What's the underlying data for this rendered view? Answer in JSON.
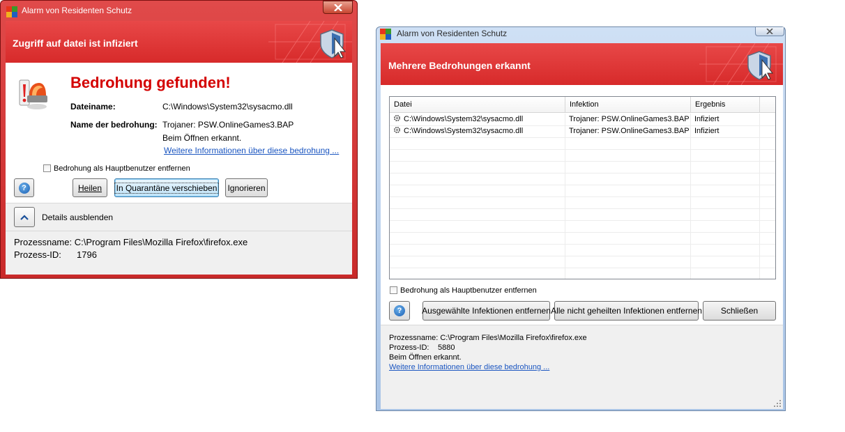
{
  "window1": {
    "title": "Alarm von Residenten Schutz",
    "banner_title": "Zugriff auf datei ist infiziert",
    "headline": "Bedrohung gefunden!",
    "file_label": "Dateiname:",
    "file_value": "C:\\Windows\\System32\\sysacmo.dll",
    "threat_label": "Name der bedrohung:",
    "threat_value": "Trojaner: PSW.OnlineGames3.BAP",
    "detected_text": "Beim Öffnen erkannt.",
    "more_info_link": "Weitere Informationen über diese bedrohung ...",
    "checkbox_label": "Bedrohung als Hauptbenutzer entfernen",
    "buttons": {
      "heal": "Heilen",
      "quarantine": "In Quarantäne verschieben",
      "ignore": "Ignorieren"
    },
    "details_toggle": "Details ausblenden",
    "process_name_line": "Prozessname: C:\\Program Files\\Mozilla Firefox\\firefox.exe",
    "process_id_label": "Prozess-ID:",
    "process_id_value": "1796"
  },
  "window2": {
    "title": "Alarm von Residenten Schutz",
    "banner_title": "Mehrere Bedrohungen erkannt",
    "columns": [
      "Datei",
      "Infektion",
      "Ergebnis"
    ],
    "rows": [
      {
        "file": "C:\\Windows\\System32\\sysacmo.dll",
        "infection": "Trojaner: PSW.OnlineGames3.BAP",
        "result": "Infiziert"
      },
      {
        "file": "C:\\Windows\\System32\\sysacmo.dll",
        "infection": "Trojaner: PSW.OnlineGames3.BAP",
        "result": "Infiziert"
      }
    ],
    "checkbox_label": "Bedrohung als Hauptbenutzer entfernen",
    "buttons": {
      "remove_selected": "Ausgewählte Infektionen entfernen",
      "remove_all": "Alle nicht geheilten Infektionen entfernen",
      "close": "Schließen"
    },
    "process_name_line": "Prozessname: C:\\Program Files\\Mozilla Firefox\\firefox.exe",
    "process_id_label": "Prozess-ID:",
    "process_id_value": "5880",
    "detected_text": "Beim Öffnen erkannt.",
    "more_info_link": "Weitere Informationen über diese bedrohung ..."
  },
  "colors": {
    "banner_red": "#d72a2a",
    "headline_red": "#d40000",
    "frame_active_red": "#d03a3a",
    "frame_inactive_blue": "#a9c4e6",
    "link_blue": "#1a55c0"
  },
  "icons": [
    "avg-logo-icon",
    "close-icon",
    "shield-cursor-icon",
    "alarm-siren-icon",
    "help-icon",
    "chevron-up-icon",
    "gear-file-icon"
  ]
}
